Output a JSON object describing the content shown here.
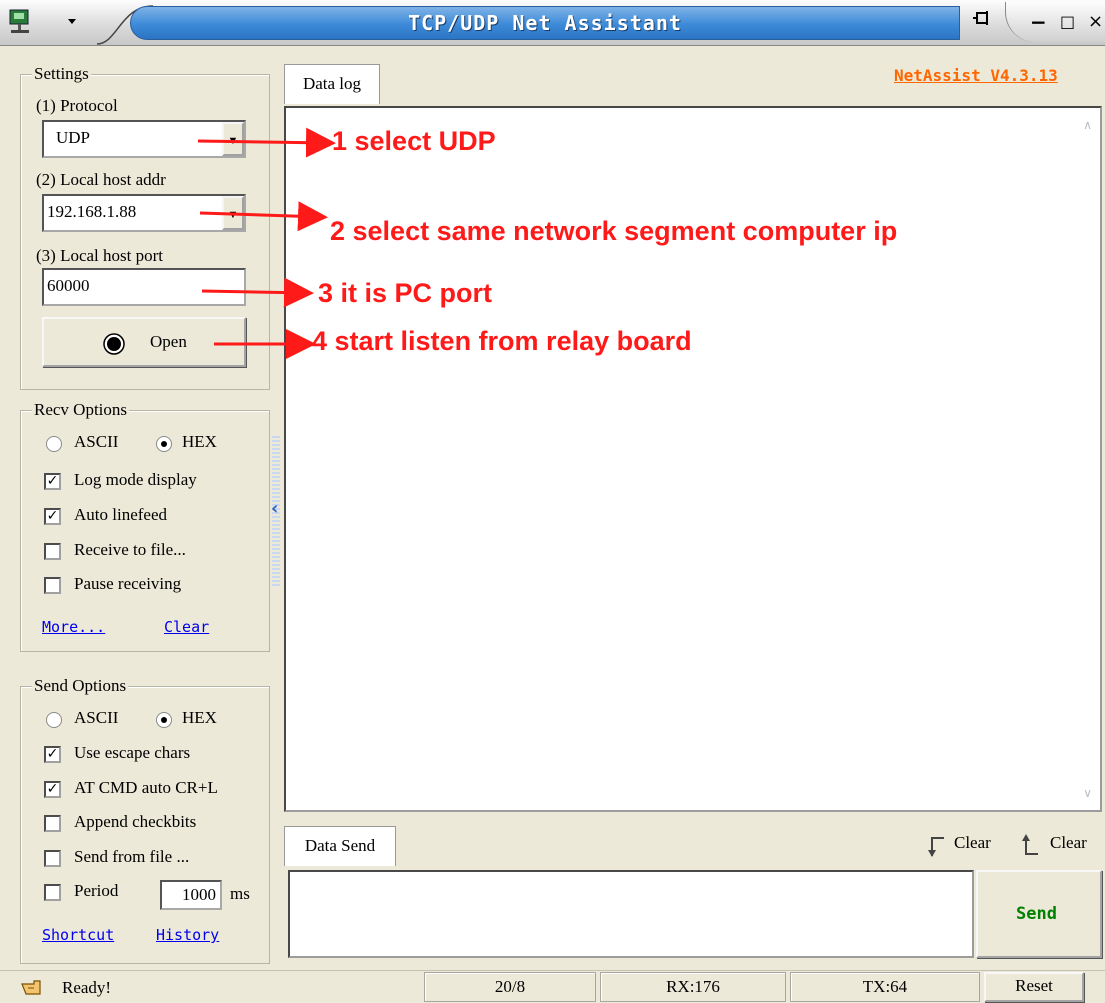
{
  "window": {
    "title": "TCP/UDP Net Assistant",
    "pin_icon": "pin-icon",
    "minimize_glyph": "−",
    "maximize_glyph": "□",
    "close_glyph": "×"
  },
  "settings": {
    "group_title": "Settings",
    "protocol_label": "(1) Protocol",
    "protocol_value": "UDP",
    "host_label": "(2) Local host addr",
    "host_value": "192.168.1.88",
    "port_label": "(3) Local host port",
    "port_value": "60000",
    "open_label": "Open"
  },
  "recv": {
    "group_title": "Recv Options",
    "ascii": "ASCII",
    "hex": "HEX",
    "selected": "HEX",
    "log_mode": "Log mode display",
    "auto_linefeed": "Auto linefeed",
    "receive_file": "Receive to file...",
    "pause": "Pause receiving",
    "more": "More...",
    "clear": "Clear"
  },
  "send": {
    "group_title": "Send Options",
    "ascii": "ASCII",
    "hex": "HEX",
    "selected": "HEX",
    "escape": "Use escape chars",
    "at_cmd": "AT CMD auto CR+L",
    "append": "Append checkbits",
    "from_file": "Send from file ...",
    "period": "Period",
    "period_value": "1000",
    "period_unit": "ms",
    "shortcut": "Shortcut",
    "history": "History"
  },
  "datalog": {
    "tab": "Data log",
    "version": "NetAssist V4.3.13"
  },
  "datasend": {
    "tab": "Data Send",
    "clear1": "Clear",
    "clear2": "Clear",
    "send_button": "Send"
  },
  "annotations": [
    "1 select UDP",
    "2 select same network segment computer ip",
    "3 it is PC port",
    "4 start listen from relay board"
  ],
  "status": {
    "ready": "Ready!",
    "counts": "20/8",
    "rx": "RX:176",
    "tx": "TX:64",
    "reset": "Reset"
  },
  "colors": {
    "annotation": "#ff1a1a",
    "version_link": "#ff6600",
    "send_text": "#008000",
    "title_bar": "#3c8ad8"
  }
}
